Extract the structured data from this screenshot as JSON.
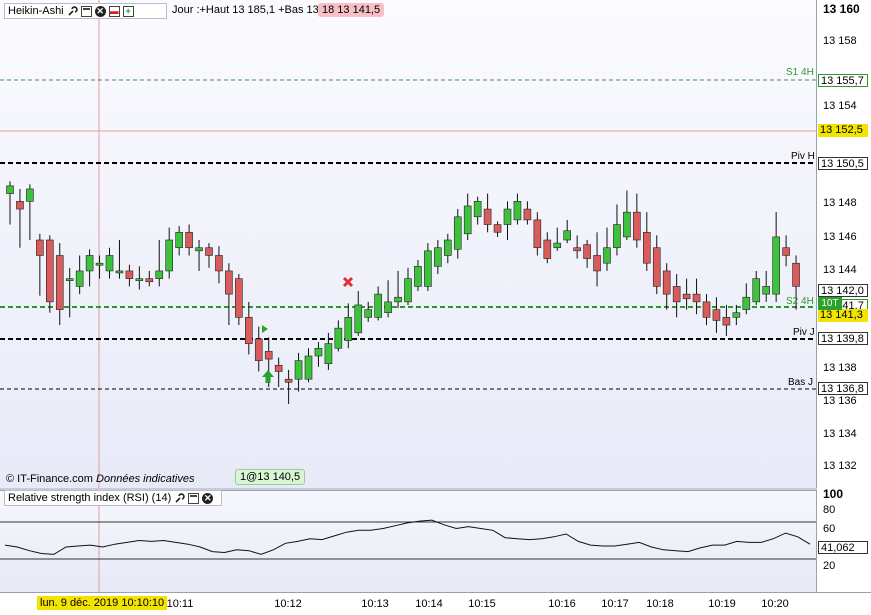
{
  "chart_header": {
    "chart_type": "Heikin-Ashi",
    "info": "Jour :+Haut 13 185,1 +Bas 13 1",
    "info_pill": "18 13 141,5",
    "icons": [
      "wrench-icon",
      "window-icon",
      "close-icon",
      "delete-icon",
      "plus-icon"
    ]
  },
  "rsi_header": {
    "title": "Relative strength index (RSI) (14)",
    "icons": [
      "wrench-icon",
      "window-icon",
      "close-icon"
    ]
  },
  "footer": {
    "copyright": "© IT-Finance.com",
    "disclaimer": "Données indicatives",
    "order_pill": "1@13 140,5"
  },
  "levels": {
    "s1": {
      "name": "S1 4H",
      "value": "13 155,7"
    },
    "current": {
      "value": "13 152,5"
    },
    "piv_h": {
      "name": "Piv H",
      "value": "13 150,5"
    },
    "price_now": {
      "value": "13 142,0"
    },
    "s2": {
      "name": "S2 4H",
      "value": "13 141,7"
    },
    "tag_10t": "10T",
    "price_last": {
      "value": "13 141,3"
    },
    "piv_j": {
      "name": "Piv J",
      "value": "13 139,8"
    },
    "bas_j": {
      "name": "Bas J",
      "value": "13 136,8"
    }
  },
  "price_axis": [
    "13 160",
    "13 158",
    "13 156",
    "13 154",
    "13 150",
    "13 148",
    "13 146",
    "13 144",
    "13 140",
    "13 138",
    "13 136",
    "13 134",
    "13 132"
  ],
  "rsi_axis": [
    "100",
    "80",
    "60",
    "20"
  ],
  "rsi_value": "41,062",
  "time_axis": {
    "current": "lun. 9 déc. 2019 10:10:10",
    "labels": [
      "10:11",
      "10:12",
      "10:13",
      "10:14",
      "10:15",
      "10:16",
      "10:17",
      "10:18",
      "10:19",
      "10:20"
    ]
  },
  "colors": {
    "bull": "#3ec23e",
    "bear": "#d85c5c",
    "axis_bg": "#ffffff",
    "plot_bg": "#eef0fa"
  },
  "chart_data": {
    "type": "candlestick",
    "ylim": [
      13131,
      13161
    ],
    "candles": [
      [
        13149,
        13149.5,
        13147,
        13149.8
      ],
      [
        13148.5,
        13148,
        13145.5,
        13149.3
      ],
      [
        13148.5,
        13149.3,
        13146,
        13149.6
      ],
      [
        13146,
        13145,
        13142.4,
        13146.4
      ],
      [
        13146,
        13142,
        13141.3,
        13146.3
      ],
      [
        13145,
        13141.5,
        13140.5,
        13145.8
      ],
      [
        13143.5,
        13143.5,
        13141,
        13144.2
      ],
      [
        13143,
        13144,
        13142.5,
        13145
      ],
      [
        13144,
        13145,
        13143,
        13145.4
      ],
      [
        13144.5,
        13144.5,
        13143.5,
        13145
      ],
      [
        13144,
        13145,
        13143.5,
        13145.5
      ],
      [
        13144,
        13144,
        13143.5,
        13146
      ],
      [
        13144,
        13143.5,
        13143,
        13144.4
      ],
      [
        13143.5,
        13143.5,
        13142.8,
        13144.3
      ],
      [
        13143.5,
        13143.3,
        13143,
        13144
      ],
      [
        13143.5,
        13144,
        13143,
        13146
      ],
      [
        13144,
        13146,
        13143.5,
        13146.8
      ],
      [
        13145.5,
        13146.5,
        13145,
        13146.9
      ],
      [
        13146.5,
        13145.5,
        13145,
        13147
      ],
      [
        13145.3,
        13145.5,
        13144,
        13146
      ],
      [
        13145.5,
        13145,
        13144.2,
        13145.8
      ],
      [
        13145,
        13144,
        13143.2,
        13145.6
      ],
      [
        13144,
        13142.5,
        13140.5,
        13144.5
      ],
      [
        13143.5,
        13141,
        13140.5,
        13143.8
      ],
      [
        13141,
        13139.3,
        13138.6,
        13142
      ],
      [
        13139.6,
        13138.2,
        13137.5,
        13140.4
      ],
      [
        13138.8,
        13138.3,
        13136.5,
        13139.7
      ],
      [
        13137.9,
        13137.5,
        13136.5,
        13138.4
      ],
      [
        13137,
        13136.8,
        13135.4,
        13137.6
      ],
      [
        13137,
        13138.2,
        13136.2,
        13138.7
      ],
      [
        13137,
        13138.5,
        13136.8,
        13139
      ],
      [
        13138.5,
        13139,
        13137.8,
        13139.4
      ],
      [
        13138,
        13139.3,
        13137.6,
        13140
      ],
      [
        13139,
        13140.3,
        13138.8,
        13140.8
      ],
      [
        13139.5,
        13141,
        13139,
        13141.9
      ],
      [
        13140,
        13141.8,
        13139.8,
        13142.7
      ],
      [
        13141,
        13141.5,
        13140.7,
        13142
      ],
      [
        13141,
        13142.5,
        13140.8,
        13143
      ],
      [
        13141.3,
        13142,
        13141,
        13143.4
      ],
      [
        13142,
        13142.3,
        13141.6,
        13144
      ],
      [
        13142,
        13143.5,
        13141.8,
        13144.2
      ],
      [
        13143,
        13144.3,
        13142.7,
        13144.7
      ],
      [
        13143,
        13145.3,
        13142.7,
        13145.8
      ],
      [
        13144.3,
        13145.5,
        13143.8,
        13146
      ],
      [
        13145,
        13146,
        13144.5,
        13146.4
      ],
      [
        13145.4,
        13147.5,
        13144.8,
        13148
      ],
      [
        13146.4,
        13148.2,
        13146,
        13149
      ],
      [
        13147.5,
        13148.5,
        13147,
        13148.8
      ],
      [
        13148,
        13147,
        13146.5,
        13149
      ],
      [
        13147,
        13146.5,
        13146.2,
        13147.2
      ],
      [
        13147,
        13148,
        13146,
        13148.5
      ],
      [
        13147.3,
        13148.5,
        13147,
        13149
      ],
      [
        13148,
        13147.3,
        13147,
        13148.5
      ],
      [
        13147.3,
        13145.5,
        13145,
        13147.8
      ],
      [
        13146,
        13144.8,
        13144.5,
        13146.5
      ],
      [
        13145.5,
        13145.8,
        13145.3,
        13146.8
      ],
      [
        13146,
        13146.6,
        13145.8,
        13147.3
      ],
      [
        13145.5,
        13145.3,
        13144.8,
        13146.3
      ],
      [
        13145.7,
        13144.8,
        13144.2,
        13146
      ],
      [
        13145,
        13144,
        13143,
        13146.5
      ],
      [
        13144.5,
        13145.5,
        13144,
        13146.8
      ],
      [
        13145.5,
        13147,
        13145,
        13148.3
      ],
      [
        13146.2,
        13147.8,
        13146,
        13149.2
      ],
      [
        13147.8,
        13146,
        13145.5,
        13149
      ],
      [
        13146.5,
        13144.5,
        13144,
        13147.8
      ],
      [
        13145.5,
        13143,
        13142.5,
        13146.3
      ],
      [
        13144,
        13142.5,
        13141.5,
        13144.5
      ],
      [
        13143,
        13142,
        13141,
        13143.8
      ],
      [
        13142.5,
        13142.2,
        13141.5,
        13143.5
      ],
      [
        13142.5,
        13142,
        13141.2,
        13143.5
      ],
      [
        13142,
        13141,
        13140.5,
        13142.5
      ],
      [
        13141.5,
        13140.8,
        13140,
        13142.3
      ],
      [
        13141,
        13140.5,
        13139.8,
        13141.8
      ],
      [
        13141,
        13141.3,
        13140.5,
        13141.8
      ],
      [
        13141.5,
        13142.3,
        13141.2,
        13143.2
      ],
      [
        13142,
        13143.5,
        13141.8,
        13144
      ],
      [
        13142.5,
        13143,
        13142,
        13144
      ],
      [
        13142.5,
        13146.2,
        13142,
        13147.8
      ],
      [
        13145.5,
        13145,
        13144.3,
        13146.3
      ],
      [
        13144.5,
        13143,
        13141.5,
        13145
      ]
    ],
    "rsi": [
      45,
      43,
      39,
      36,
      35,
      43,
      44,
      45,
      43,
      46,
      48,
      50,
      49,
      50,
      48,
      46,
      43,
      38,
      37,
      40,
      39,
      35,
      40,
      47,
      49,
      52,
      51,
      55,
      59,
      61,
      61,
      63,
      66,
      69,
      71,
      72,
      67,
      63,
      65,
      63,
      61,
      53,
      52,
      51,
      52,
      54,
      57,
      49,
      45,
      44,
      44,
      46,
      48,
      43,
      40,
      39,
      38,
      42,
      45,
      45,
      49,
      48,
      48,
      52,
      58,
      54,
      46
    ],
    "rsi_lines": [
      70,
      30
    ]
  }
}
